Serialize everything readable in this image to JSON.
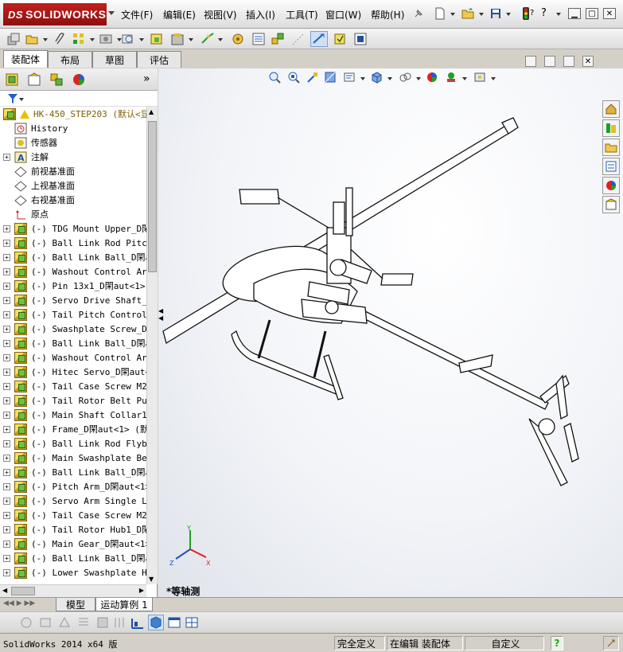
{
  "app": {
    "logo_text": "SOLIDWORKS",
    "logo_ds": "DS"
  },
  "menu": [
    {
      "label": "文件(F)"
    },
    {
      "label": "编辑(E)"
    },
    {
      "label": "视图(V)"
    },
    {
      "label": "插入(I)"
    },
    {
      "label": "工具(T)"
    },
    {
      "label": "窗口(W)"
    },
    {
      "label": "帮助(H)"
    }
  ],
  "help_marker": "?",
  "tabs": [
    {
      "label": "装配体",
      "active": true
    },
    {
      "label": "布局",
      "active": false
    },
    {
      "label": "草图",
      "active": false
    },
    {
      "label": "评估",
      "active": false
    }
  ],
  "tree": {
    "root": "HK-450_STEP203  (默认<显",
    "items": [
      {
        "label": "History",
        "icon": "history-icon",
        "expandable": false
      },
      {
        "label": "传感器",
        "icon": "sensor-icon",
        "expandable": false
      },
      {
        "label": "注解",
        "icon": "annotation-icon",
        "expandable": true
      },
      {
        "label": "前视基准面",
        "icon": "plane-icon",
        "expandable": false
      },
      {
        "label": "上视基准面",
        "icon": "plane-icon",
        "expandable": false
      },
      {
        "label": "右视基准面",
        "icon": "plane-icon",
        "expandable": false
      },
      {
        "label": "原点",
        "icon": "origin-icon",
        "expandable": false
      },
      {
        "label": "(-) TDG Mount Upper_D閑",
        "icon": "part-icon",
        "expandable": true
      },
      {
        "label": "(-) Ball Link Rod Pitch",
        "icon": "part-icon",
        "expandable": true
      },
      {
        "label": "(-) Ball Link Ball_D閑a",
        "icon": "part-icon",
        "expandable": true
      },
      {
        "label": "(-) Washout Control Arm",
        "icon": "part-icon",
        "expandable": true
      },
      {
        "label": "(-) Pin 13x1_D閑aut<1>",
        "icon": "part-icon",
        "expandable": true
      },
      {
        "label": "(-) Servo Drive Shaft_D",
        "icon": "part-icon",
        "expandable": true
      },
      {
        "label": "(-) Tail Pitch Control_",
        "icon": "part-icon",
        "expandable": true
      },
      {
        "label": "(-) Swashplate Screw_D閑",
        "icon": "part-icon",
        "expandable": true
      },
      {
        "label": "(-) Ball Link Ball_D閑a",
        "icon": "part-icon",
        "expandable": true
      },
      {
        "label": "(-) Washout Control Arm",
        "icon": "part-icon",
        "expandable": true
      },
      {
        "label": "(-) Hitec Servo_D閑aut<",
        "icon": "part-icon",
        "expandable": true
      },
      {
        "label": "(-) Tail Case Screw M2x",
        "icon": "part-icon",
        "expandable": true
      },
      {
        "label": "(-) Tail Rotor Belt Pul",
        "icon": "part-icon",
        "expandable": true
      },
      {
        "label": "(-) Main Shaft Collar1_",
        "icon": "part-icon",
        "expandable": true
      },
      {
        "label": "(-) Frame_D閑aut<1> (默",
        "icon": "part-icon",
        "expandable": true
      },
      {
        "label": "(-) Ball Link Rod Flyba",
        "icon": "part-icon",
        "expandable": true
      },
      {
        "label": "(-) Main Swashplate Bea",
        "icon": "part-icon",
        "expandable": true
      },
      {
        "label": "(-) Ball Link Ball_D閑a",
        "icon": "part-icon",
        "expandable": true
      },
      {
        "label": "(-) Pitch Arm_D閑aut<1>",
        "icon": "part-icon",
        "expandable": true
      },
      {
        "label": "(-) Servo Arm Single Lo",
        "icon": "part-icon",
        "expandable": true
      },
      {
        "label": "(-) Tail Case Screw M2x",
        "icon": "part-icon",
        "expandable": true
      },
      {
        "label": "(-) Tail Rotor Hub1_D閑",
        "icon": "part-icon",
        "expandable": true
      },
      {
        "label": "(-) Main Gear_D閑aut<1>",
        "icon": "part-icon",
        "expandable": true
      },
      {
        "label": "(-) Ball Link Ball_D閑a",
        "icon": "part-icon",
        "expandable": true
      },
      {
        "label": "(-) Lower Swashplate Ho",
        "icon": "part-icon",
        "expandable": true
      }
    ]
  },
  "viewport": {
    "view_label": "*等轴测",
    "axis": {
      "x": "X",
      "y": "Y",
      "z": "Z"
    }
  },
  "bottom_tabs": [
    {
      "label": "模型",
      "active": false
    },
    {
      "label": "运动算例 1",
      "active": true
    }
  ],
  "status": {
    "app_version": "SolidWorks 2014 x64 版",
    "definition": "完全定义",
    "mode": "在编辑 装配体",
    "units": "自定义",
    "help": "?"
  },
  "colors": {
    "logo_red": "#b01818",
    "viewport_bg": "#f2f4f8"
  }
}
